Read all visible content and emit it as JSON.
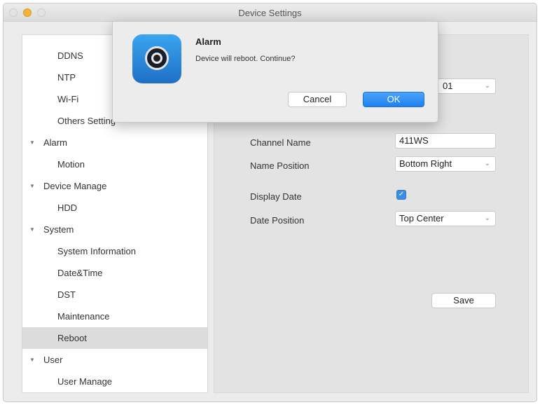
{
  "window": {
    "title": "Device Settings"
  },
  "sidebar": {
    "items": [
      {
        "label": "DDNS",
        "kind": "child"
      },
      {
        "label": "NTP",
        "kind": "child"
      },
      {
        "label": "Wi-Fi",
        "kind": "child"
      },
      {
        "label": "Others Setting",
        "kind": "child"
      },
      {
        "label": "Alarm",
        "kind": "group"
      },
      {
        "label": "Motion",
        "kind": "child"
      },
      {
        "label": "Device Manage",
        "kind": "group"
      },
      {
        "label": "HDD",
        "kind": "child"
      },
      {
        "label": "System",
        "kind": "group"
      },
      {
        "label": "System Information",
        "kind": "child"
      },
      {
        "label": "Date&Time",
        "kind": "child"
      },
      {
        "label": "DST",
        "kind": "child"
      },
      {
        "label": "Maintenance",
        "kind": "child"
      },
      {
        "label": "Reboot",
        "kind": "child",
        "selected": true
      },
      {
        "label": "User",
        "kind": "group"
      },
      {
        "label": "User Manage",
        "kind": "child"
      }
    ]
  },
  "content": {
    "top_select_value": "01",
    "channel_name_label": "Channel Name",
    "channel_name_value": "411WS",
    "name_position_label": "Name Position",
    "name_position_value": "Bottom Right",
    "display_date_label": "Display Date",
    "display_date_checked": true,
    "date_position_label": "Date Position",
    "date_position_value": "Top Center",
    "save_label": "Save"
  },
  "dialog": {
    "title": "Alarm",
    "message": "Device will reboot. Continue?",
    "cancel_label": "Cancel",
    "ok_label": "OK"
  },
  "colors": {
    "accent": "#1f80ef",
    "checkbox": "#3a8ee6",
    "window_bg": "#ececec"
  }
}
